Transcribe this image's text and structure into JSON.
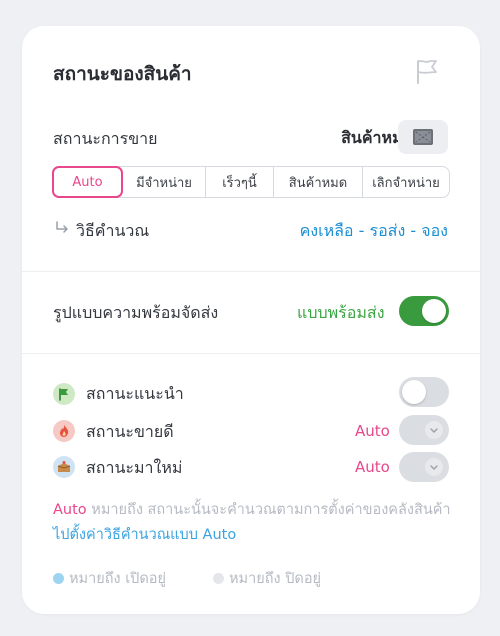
{
  "title": "สถานะของสินค้า",
  "sale": {
    "label": "สถานะการขาย",
    "value": "สินค้าหมด",
    "segments": [
      "Auto",
      "มีจำหน่าย",
      "เร็วๆนี้",
      "สินค้าหมด",
      "เลิกจำหน่าย"
    ],
    "active_segment": "Auto"
  },
  "calc": {
    "label": "วิธีคำนวณ",
    "value": "คงเหลือ - รอส่ง - จอง"
  },
  "ready": {
    "label": "รูปแบบความพร้อมจัดส่ง",
    "value": "แบบพร้อมส่ง",
    "enabled": true
  },
  "statuses": [
    {
      "label": "สถานะแนะนำ",
      "icon": "recommend-flag-icon",
      "control": "toggle",
      "enabled": false
    },
    {
      "label": "สถานะขายดี",
      "icon": "fire-icon",
      "control": "dropdown",
      "value": "Auto"
    },
    {
      "label": "สถานะมาใหม่",
      "icon": "new-box-icon",
      "control": "dropdown",
      "value": "Auto"
    }
  ],
  "note": {
    "prefix": "Auto",
    "text": " หมายถึง สถานะนั้นจะคำนวณตามการตั้งค่าของคลังสินค้า ",
    "link": "ไปตั้งค่าวิธีคำนวณแบบ Auto"
  },
  "legend": {
    "on": "หมายถึง เปิดอยู่",
    "off": "หมายถึง ปิดอยู่"
  },
  "colors": {
    "accent_pink": "#e8478b",
    "link_blue": "#1c8fd4",
    "ready_green": "#3aa543",
    "toggle_on": "#3a9b3e",
    "legend_on_dot": "#9fd3f2",
    "legend_off_dot": "#e4e6ea"
  }
}
